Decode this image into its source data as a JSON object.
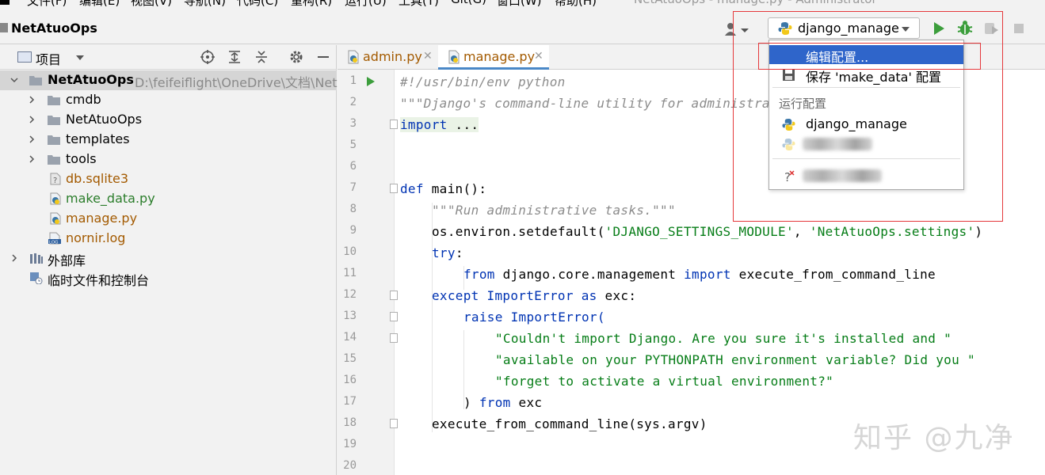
{
  "menu": {
    "items": [
      "文件(F)",
      "编辑(E)",
      "视图(V)",
      "导航(N)",
      "代码(C)",
      "重构(R)",
      "运行(U)",
      "工具(T)",
      "Git(G)",
      "窗口(W)",
      "帮助(H)"
    ],
    "window_title": "NetAtuoOps - manage.py - Administrator"
  },
  "navbar": {
    "project_name": "NetAtuoOps",
    "run_config": "django_manage"
  },
  "project_panel": {
    "title": "项目",
    "root_name": "NetAtuoOps",
    "root_path": "D:\\feifeiflight\\OneDrive\\文档\\Net",
    "folders": [
      "cmdb",
      "NetAtuoOps",
      "templates",
      "tools"
    ],
    "files": [
      {
        "name": "db.sqlite3",
        "color": "#a35a00"
      },
      {
        "name": "make_data.py",
        "color": "#2b7d2b"
      },
      {
        "name": "manage.py",
        "color": "#a35a00"
      },
      {
        "name": "nornir.log",
        "color": "#a35a00"
      }
    ],
    "external_libs": "外部库",
    "scratches": "临时文件和控制台"
  },
  "editor": {
    "tabs": [
      {
        "name": "admin.py",
        "active": false
      },
      {
        "name": "manage.py",
        "active": true
      }
    ],
    "line_numbers": [
      "1",
      "2",
      "3",
      "5",
      "6",
      "7",
      "8",
      "9",
      "10",
      "11",
      "12",
      "13",
      "14",
      "15",
      "16",
      "17",
      "18",
      "19",
      "20"
    ],
    "code": {
      "l1": "#!/usr/bin/env python",
      "l2": "\"\"\"Django's command-line utility for administra",
      "l3_kw": "import",
      "l3_rest": " ...",
      "l7_kw": "def",
      "l7_rest": " main():",
      "l8": "\"\"\"Run administrative tasks.\"\"\"",
      "l9_a": "os.environ.setdefault(",
      "l9_s1": "'DJANGO_SETTINGS_MODULE'",
      "l9_b": ", ",
      "l9_s2": "'NetAtuoOps.settings'",
      "l9_c": ")",
      "l10_kw": "try",
      "l10_rest": ":",
      "l11_kw1": "from",
      "l11_a": " django.core.management ",
      "l11_kw2": "import",
      "l11_b": " execute_from_command_line",
      "l12_kw1": "except",
      "l12_a": " ImportError ",
      "l12_kw2": "as",
      "l12_b": " exc:",
      "l13_kw": "raise",
      "l13_rest": " ImportError(",
      "l14": "\"Couldn't import Django. Are you sure it's installed and \"",
      "l15": "\"available on your PYTHONPATH environment variable? Did you \"",
      "l16": "\"forget to activate a virtual environment?\"",
      "l17_a": ") ",
      "l17_kw": "from",
      "l17_b": " exc",
      "l18": "execute_from_command_line(sys.argv)"
    }
  },
  "popup": {
    "edit_config": "编辑配置...",
    "save_config": "保存 'make_data' 配置",
    "group_label": "运行配置",
    "config_item": "django_manage"
  },
  "watermark": "知乎 @九净",
  "colors": {
    "accent": "#2f65ca",
    "highlight_box": "#e5383b",
    "run_green": "#3c9e3c"
  }
}
